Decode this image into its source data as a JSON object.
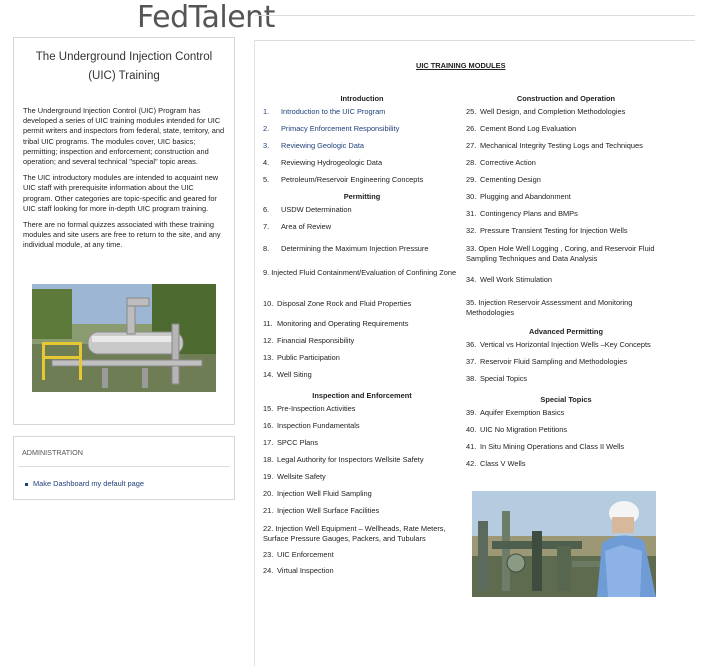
{
  "brand": {
    "logo_text": "FedTalent"
  },
  "sidebar": {
    "title": "The Underground Injection Control (UIC) Training",
    "paragraphs": [
      "The Underground Injection Control (UIC) Program has developed a series of UIC training modules intended for UIC permit writers and inspectors from federal, state, territory, and tribal UIC programs. The modules cover, UIC basics; permitting; inspection and enforcement; construction and operation; and several technical \"special\" topic areas.",
      "The UIC introductory modules are intended to acquaint new UIC staff with prerequisite information about the UIC program. Other categories are topic-specific and geared for UIC staff looking for more in-depth UIC program training.",
      "There are no formal quizzes associated with these training modules and site users are free to return to the site, and any individual module, at any time."
    ],
    "admin": {
      "title": "ADMINISTRATION",
      "link": "Make Dashboard my default page"
    }
  },
  "main": {
    "heading": "UIC TRAINING MODULES",
    "left": {
      "intro_head": "Introduction",
      "intro": [
        {
          "num": "1.",
          "label": "Introduction to the UIC Program"
        },
        {
          "num": "2.",
          "label": "Primacy Enforcement Responsibility"
        },
        {
          "num": "3.",
          "label": "Reviewing Geologic Data"
        },
        {
          "num": "4.",
          "label": "Reviewing Hydrogeologic Data"
        },
        {
          "num": "5.",
          "label": "Petroleum/Reservoir Engineering Concepts"
        }
      ],
      "permit_head": "Permitting",
      "permit": [
        {
          "num": "6.",
          "label": "USDW Determination"
        },
        {
          "num": "7.",
          "label": "Area of Review"
        },
        {
          "num": "8.",
          "label": "Determining the Maximum Injection Pressure"
        },
        {
          "num": "9.",
          "label": "Injected Fluid Containment/Evaluation of Confining Zone"
        },
        {
          "num": "10.",
          "label": "Disposal Zone Rock and Fluid Properties"
        },
        {
          "num": "11.",
          "label": "Monitoring and Operating Requirements"
        },
        {
          "num": "12.",
          "label": "Financial Responsibility"
        },
        {
          "num": "13.",
          "label": "Public Participation"
        },
        {
          "num": "14.",
          "label": "Well Siting"
        }
      ],
      "insp_head": "Inspection and Enforcement",
      "insp": [
        {
          "num": "15.",
          "label": "Pre-Inspection Activities"
        },
        {
          "num": "16.",
          "label": "Inspection Fundamentals"
        },
        {
          "num": "17.",
          "label": "SPCC Plans"
        },
        {
          "num": "18.",
          "label": "Legal Authority for Inspectors Wellsite Safety"
        },
        {
          "num": "19.",
          "label": "Wellsite Safety"
        },
        {
          "num": "20.",
          "label": "Injection Well Fluid Sampling"
        },
        {
          "num": "21.",
          "label": "Injection Well Surface Facilities"
        },
        {
          "num": "22.",
          "label": "Injection Well Equipment – Wellheads, Rate Meters, Surface Pressure Gauges, Packers, and Tubulars"
        },
        {
          "num": "23.",
          "label": "UIC Enforcement"
        },
        {
          "num": "24.",
          "label": "Virtual Inspection"
        }
      ]
    },
    "right": {
      "const_head": "Construction and Operation",
      "const": [
        {
          "num": "25.",
          "label": "Well Design, and Completion Methodologies"
        },
        {
          "num": "26.",
          "label": "Cement Bond Log Evaluation"
        },
        {
          "num": "27.",
          "label": "Mechanical Integrity Testing Logs and Techniques"
        },
        {
          "num": "28.",
          "label": "Corrective Action"
        },
        {
          "num": "29.",
          "label": "Cementing Design"
        },
        {
          "num": "30.",
          "label": "Plugging and Abandonment"
        },
        {
          "num": "31.",
          "label": "Contingency Plans and BMPs"
        },
        {
          "num": "32.",
          "label": "Pressure Transient Testing for Injection Wells"
        },
        {
          "num": "33.",
          "label": "Open Hole Well Logging , Coring, and Reservoir Fluid Sampling Techniques and Data Analysis"
        },
        {
          "num": "34.",
          "label": "Well Work Stimulation"
        },
        {
          "num": "35.",
          "label": "Injection Reservoir Assessment and Monitoring Methodologies"
        }
      ],
      "adv_head": "Advanced Permitting",
      "adv": [
        {
          "num": "36.",
          "label": "Vertical vs Horizontal Injection Wells –Key Concepts"
        },
        {
          "num": "37.",
          "label": "Reservoir Fluid Sampling and Methodologies"
        },
        {
          "num": "38.",
          "label": "Special Topics"
        }
      ],
      "special_head": "Special Topics",
      "special": [
        {
          "num": "39.",
          "label": "Aquifer Exemption Basics"
        },
        {
          "num": "40.",
          "label": "UIC No Migration Petitions"
        },
        {
          "num": "41.",
          "label": "In Situ Mining Operations and Class II Wells"
        },
        {
          "num": "42.",
          "label": "Class V Wells"
        }
      ]
    }
  }
}
